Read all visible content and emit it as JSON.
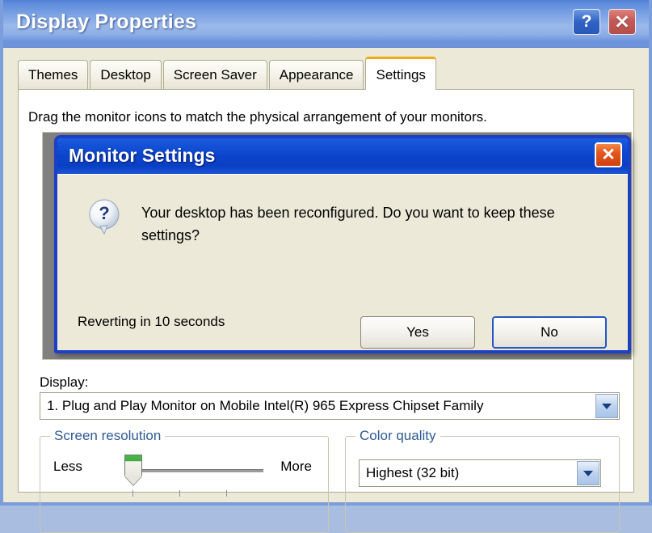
{
  "window": {
    "title": "Display Properties",
    "help_button": "?",
    "close_button": "✕",
    "help_icon_name": "help-icon",
    "close_icon_name": "close-icon"
  },
  "tabs": [
    {
      "label": "Themes",
      "active": false
    },
    {
      "label": "Desktop",
      "active": false
    },
    {
      "label": "Screen Saver",
      "active": false
    },
    {
      "label": "Appearance",
      "active": false
    },
    {
      "label": "Settings",
      "active": true
    }
  ],
  "settings_tab": {
    "drag_hint": "Drag the monitor icons to match the physical arrangement of your monitors.",
    "display": {
      "label": "Display:",
      "selected": "1. Plug and Play Monitor on Mobile Intel(R) 965 Express Chipset Family",
      "arrow": "▼"
    },
    "screen_resolution": {
      "title": "Screen resolution",
      "min_label": "Less",
      "max_label": "More"
    },
    "color_quality": {
      "title": "Color quality",
      "selected": "Highest (32 bit)",
      "arrow": "▼"
    }
  },
  "dialog": {
    "title": "Monitor Settings",
    "close_button": "✕",
    "icon_name": "question-mark-icon",
    "message": "Your desktop has been reconfigured.  Do you want to keep these settings?",
    "revert_text": "Reverting in 10 seconds",
    "yes_label": "Yes",
    "no_label": "No"
  },
  "colors": {
    "titlebar_blue": "#7ba2e3",
    "dialog_titlebar_blue": "#0b45cc",
    "dialog_border": "#1c3fc4",
    "active_tab_accent": "#f0a913",
    "window_face": "#ece9d8",
    "groupbox_title": "#2f5b94",
    "slider_thumb_green": "#45ab45",
    "close_red": "#d1400f",
    "default_button_focus": "#2458c8"
  }
}
